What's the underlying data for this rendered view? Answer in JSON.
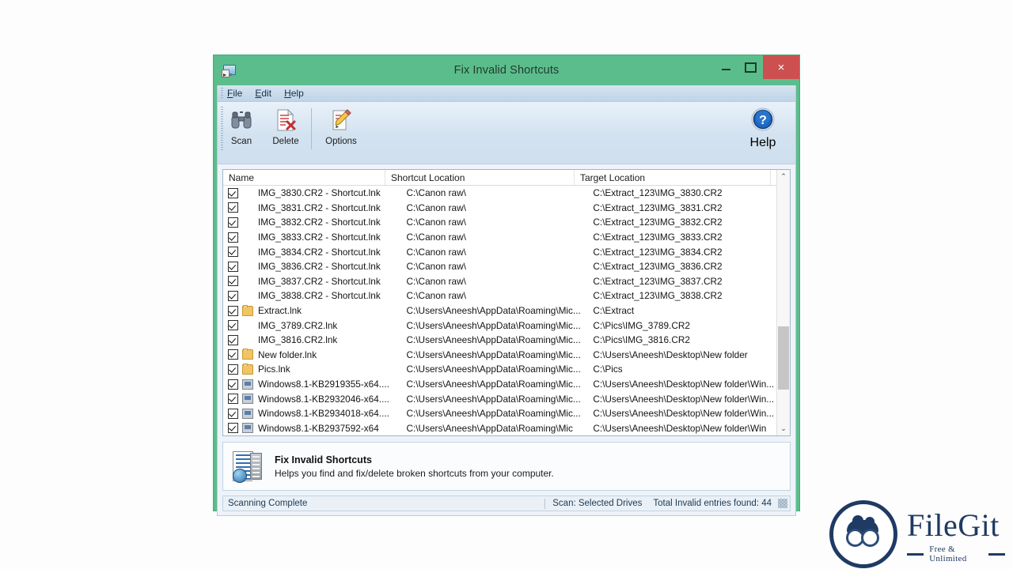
{
  "window": {
    "title": "Fix Invalid Shortcuts",
    "app_icon": "shortcut-monitor-icon",
    "buttons": {
      "minimize": "minimize-button",
      "maximize": "maximize-button",
      "close_label": "×"
    },
    "frame_color": "#5cbd8c",
    "close_color": "#cd5050"
  },
  "menubar": {
    "items": [
      {
        "label": "File"
      },
      {
        "label": "Edit"
      },
      {
        "label": "Help"
      }
    ]
  },
  "toolbar": {
    "buttons": [
      {
        "label": "Scan",
        "icon": "binoculars-icon"
      },
      {
        "label": "Delete",
        "icon": "document-delete-icon"
      },
      {
        "label": "Options",
        "icon": "document-pencil-icon"
      }
    ],
    "help": {
      "label": "Help",
      "icon": "help-question-icon"
    }
  },
  "list": {
    "columns": [
      "Name",
      "Shortcut Location",
      "Target Location",
      ""
    ],
    "rows": [
      {
        "checked": true,
        "icon": "image",
        "name": "IMG_3830.CR2 - Shortcut.lnk",
        "shortcut": "C:\\Canon raw\\",
        "target": "C:\\Extract_123\\IMG_3830.CR2"
      },
      {
        "checked": true,
        "icon": "image",
        "name": "IMG_3831.CR2 - Shortcut.lnk",
        "shortcut": "C:\\Canon raw\\",
        "target": "C:\\Extract_123\\IMG_3831.CR2"
      },
      {
        "checked": true,
        "icon": "image",
        "name": "IMG_3832.CR2 - Shortcut.lnk",
        "shortcut": "C:\\Canon raw\\",
        "target": "C:\\Extract_123\\IMG_3832.CR2"
      },
      {
        "checked": true,
        "icon": "image",
        "name": "IMG_3833.CR2 - Shortcut.lnk",
        "shortcut": "C:\\Canon raw\\",
        "target": "C:\\Extract_123\\IMG_3833.CR2"
      },
      {
        "checked": true,
        "icon": "image",
        "name": "IMG_3834.CR2 - Shortcut.lnk",
        "shortcut": "C:\\Canon raw\\",
        "target": "C:\\Extract_123\\IMG_3834.CR2"
      },
      {
        "checked": true,
        "icon": "image",
        "name": "IMG_3836.CR2 - Shortcut.lnk",
        "shortcut": "C:\\Canon raw\\",
        "target": "C:\\Extract_123\\IMG_3836.CR2"
      },
      {
        "checked": true,
        "icon": "image",
        "name": "IMG_3837.CR2 - Shortcut.lnk",
        "shortcut": "C:\\Canon raw\\",
        "target": "C:\\Extract_123\\IMG_3837.CR2"
      },
      {
        "checked": true,
        "icon": "image",
        "name": "IMG_3838.CR2 - Shortcut.lnk",
        "shortcut": "C:\\Canon raw\\",
        "target": "C:\\Extract_123\\IMG_3838.CR2"
      },
      {
        "checked": true,
        "icon": "folder",
        "name": "Extract.lnk",
        "shortcut": "C:\\Users\\Aneesh\\AppData\\Roaming\\Mic...",
        "target": "C:\\Extract"
      },
      {
        "checked": true,
        "icon": "image",
        "name": "IMG_3789.CR2.lnk",
        "shortcut": "C:\\Users\\Aneesh\\AppData\\Roaming\\Mic...",
        "target": "C:\\Pics\\IMG_3789.CR2"
      },
      {
        "checked": true,
        "icon": "image",
        "name": "IMG_3816.CR2.lnk",
        "shortcut": "C:\\Users\\Aneesh\\AppData\\Roaming\\Mic...",
        "target": "C:\\Pics\\IMG_3816.CR2"
      },
      {
        "checked": true,
        "icon": "folder",
        "name": "New folder.lnk",
        "shortcut": "C:\\Users\\Aneesh\\AppData\\Roaming\\Mic...",
        "target": "C:\\Users\\Aneesh\\Desktop\\New folder"
      },
      {
        "checked": true,
        "icon": "folder",
        "name": "Pics.lnk",
        "shortcut": "C:\\Users\\Aneesh\\AppData\\Roaming\\Mic...",
        "target": "C:\\Pics"
      },
      {
        "checked": true,
        "icon": "exe",
        "name": "Windows8.1-KB2919355-x64....",
        "shortcut": "C:\\Users\\Aneesh\\AppData\\Roaming\\Mic...",
        "target": "C:\\Users\\Aneesh\\Desktop\\New folder\\Win..."
      },
      {
        "checked": true,
        "icon": "exe",
        "name": "Windows8.1-KB2932046-x64....",
        "shortcut": "C:\\Users\\Aneesh\\AppData\\Roaming\\Mic...",
        "target": "C:\\Users\\Aneesh\\Desktop\\New folder\\Win..."
      },
      {
        "checked": true,
        "icon": "exe",
        "name": "Windows8.1-KB2934018-x64....",
        "shortcut": "C:\\Users\\Aneesh\\AppData\\Roaming\\Mic...",
        "target": "C:\\Users\\Aneesh\\Desktop\\New folder\\Win..."
      },
      {
        "checked": true,
        "icon": "exe",
        "name": "Windows8.1-KB2937592-x64",
        "shortcut": "C:\\Users\\Aneesh\\AppData\\Roaming\\Mic",
        "target": "C:\\Users\\Aneesh\\Desktop\\New folder\\Win"
      }
    ],
    "scrollbar": {
      "up": "⌃",
      "down": "⌄"
    }
  },
  "info": {
    "title": "Fix Invalid Shortcuts",
    "description": "Helps you find and fix/delete broken shortcuts from your computer.",
    "icon": "server-document-icon"
  },
  "status": {
    "left": "Scanning Complete",
    "scan_mode": "Scan: Selected Drives",
    "total": "Total Invalid entries found: 44"
  },
  "branding": {
    "name": "FileGit",
    "tagline": "Free & Unlimited",
    "icon": "binoculars-logo-icon",
    "color": "#1f3a63"
  }
}
